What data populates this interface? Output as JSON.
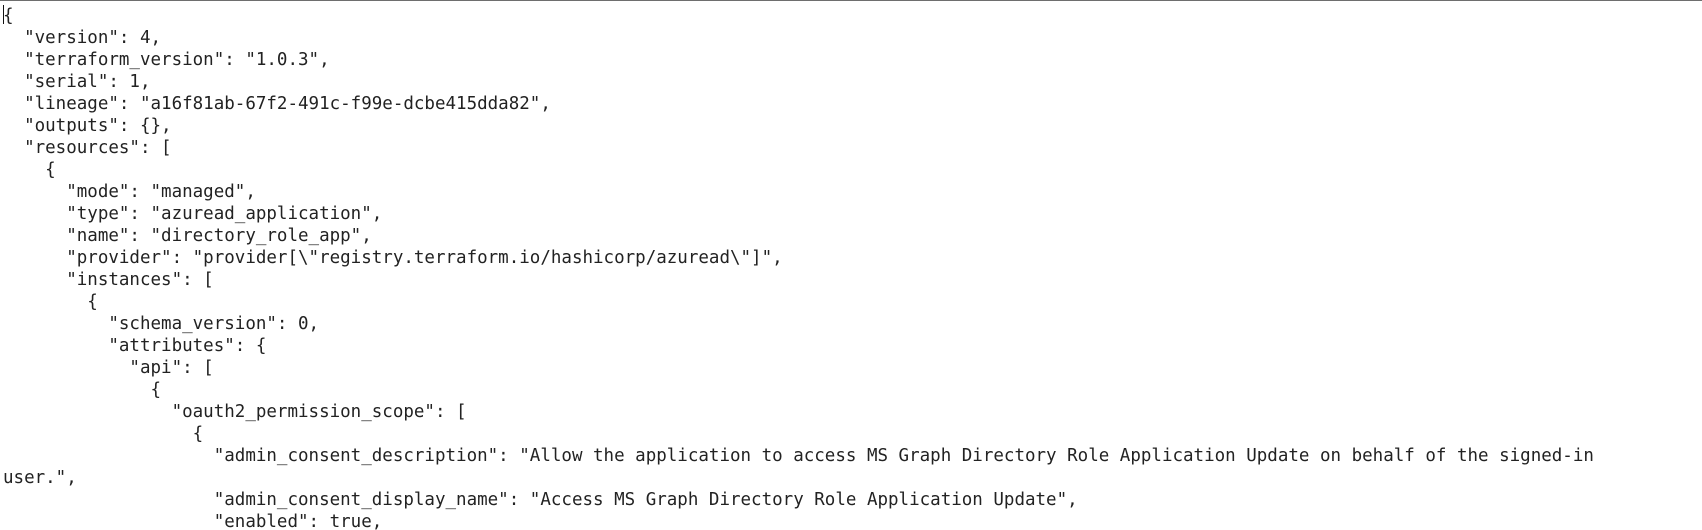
{
  "file": {
    "lines": [
      "{",
      "  \"version\": 4,",
      "  \"terraform_version\": \"1.0.3\",",
      "  \"serial\": 1,",
      "  \"lineage\": \"a16f81ab-67f2-491c-f99e-dcbe415dda82\",",
      "  \"outputs\": {},",
      "  \"resources\": [",
      "    {",
      "      \"mode\": \"managed\",",
      "      \"type\": \"azuread_application\",",
      "      \"name\": \"directory_role_app\",",
      "      \"provider\": \"provider[\\\"registry.terraform.io/hashicorp/azuread\\\"]\",",
      "      \"instances\": [",
      "        {",
      "          \"schema_version\": 0,",
      "          \"attributes\": {",
      "            \"api\": [",
      "              {",
      "                \"oauth2_permission_scope\": [",
      "                  {",
      "                    \"admin_consent_description\": \"Allow the application to access MS Graph Directory Role Application Update on behalf of the signed-in",
      "user.\",",
      "                    \"admin_consent_display_name\": \"Access MS Graph Directory Role Application Update\",",
      "                    \"enabled\": true,"
    ]
  }
}
